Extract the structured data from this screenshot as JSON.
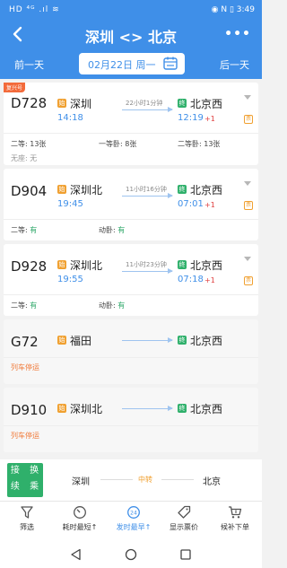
{
  "status_bar": {
    "left": "HD ⁴ᴳ .ıl ≋",
    "right": "◉ N ▯ 3:49"
  },
  "header": {
    "title": "深圳 <> 北京",
    "prev_day": "前一天",
    "next_day": "后一天",
    "date": "02月22日 周一",
    "more": "•••"
  },
  "trains": [
    {
      "badge": "复兴号",
      "number": "D728",
      "from_station": "深圳",
      "from_icon": "始",
      "dep_time": "14:18",
      "duration": "22小时1分钟",
      "to_station": "北京西",
      "to_icon": "终",
      "arr_time": "12:19",
      "day_offset": "+1",
      "seats": [
        {
          "label": "二等:",
          "value": "13张"
        },
        {
          "label": "一等卧:",
          "value": "8张"
        },
        {
          "label": "二等卧:",
          "value": "13张"
        },
        {
          "label": "无座:",
          "value": "无"
        }
      ]
    },
    {
      "number": "D904",
      "from_station": "深圳北",
      "from_icon": "始",
      "dep_time": "19:45",
      "duration": "11小时16分钟",
      "to_station": "北京西",
      "to_icon": "终",
      "arr_time": "07:01",
      "day_offset": "+1",
      "seats": [
        {
          "label": "二等:",
          "value": "有"
        },
        {
          "label": "动卧:",
          "value": "有"
        }
      ]
    },
    {
      "number": "D928",
      "from_station": "深圳北",
      "from_icon": "始",
      "dep_time": "19:55",
      "duration": "11小时23分钟",
      "to_station": "北京西",
      "to_icon": "终",
      "arr_time": "07:18",
      "day_offset": "+1",
      "seats": [
        {
          "label": "二等:",
          "value": "有"
        },
        {
          "label": "动卧:",
          "value": "有"
        }
      ]
    },
    {
      "number": "G72",
      "from_station": "福田",
      "from_icon": "始",
      "to_station": "北京西",
      "to_icon": "终",
      "status": "列车停运"
    },
    {
      "number": "D910",
      "from_station": "深圳北",
      "from_icon": "始",
      "to_station": "北京西",
      "to_icon": "终",
      "status": "列车停运"
    }
  ],
  "ticket_icon": "票",
  "transfer": {
    "badge": "接 换 续 乘",
    "from": "深圳",
    "via": "中转",
    "to": "北京"
  },
  "tabs": [
    {
      "label": "筛选",
      "icon": "filter-icon"
    },
    {
      "label": "耗时最短↑",
      "icon": "timer-icon"
    },
    {
      "label": "发时最早↑",
      "icon": "clock24-icon",
      "active": true
    },
    {
      "label": "显示票价",
      "icon": "price-tag-icon"
    },
    {
      "label": "候补下单",
      "icon": "cart-icon"
    }
  ],
  "colors": {
    "primary": "#3f8fe8",
    "orange": "#f0a030",
    "green": "#2fb06b",
    "red": "#e04040"
  }
}
